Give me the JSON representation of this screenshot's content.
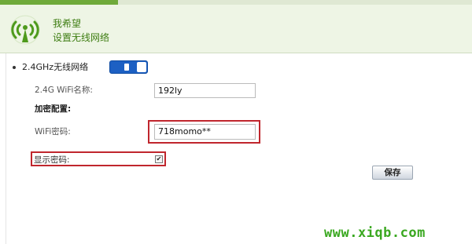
{
  "progress": {
    "fraction": 0.25
  },
  "header": {
    "title": "我希望",
    "subtitle": "设置无线网络",
    "logo_icon": "wifi-signal-icon"
  },
  "wifi": {
    "band_label": "2.4GHz无线网络",
    "toggle_state": "on",
    "ssid_label": "2.4G WiFi名称:",
    "ssid_value": "192ly",
    "encryption_heading": "加密配置:",
    "password_label": "WiFi密码:",
    "password_value": "718momo**",
    "show_password_label": "显示密码:",
    "show_password_checked": true
  },
  "actions": {
    "save_label": "保存"
  },
  "watermark": "www.xiqb.com",
  "colors": {
    "accent_green": "#6faa3a",
    "highlight_red": "#c0262d",
    "toggle_blue": "#1d60c3"
  }
}
